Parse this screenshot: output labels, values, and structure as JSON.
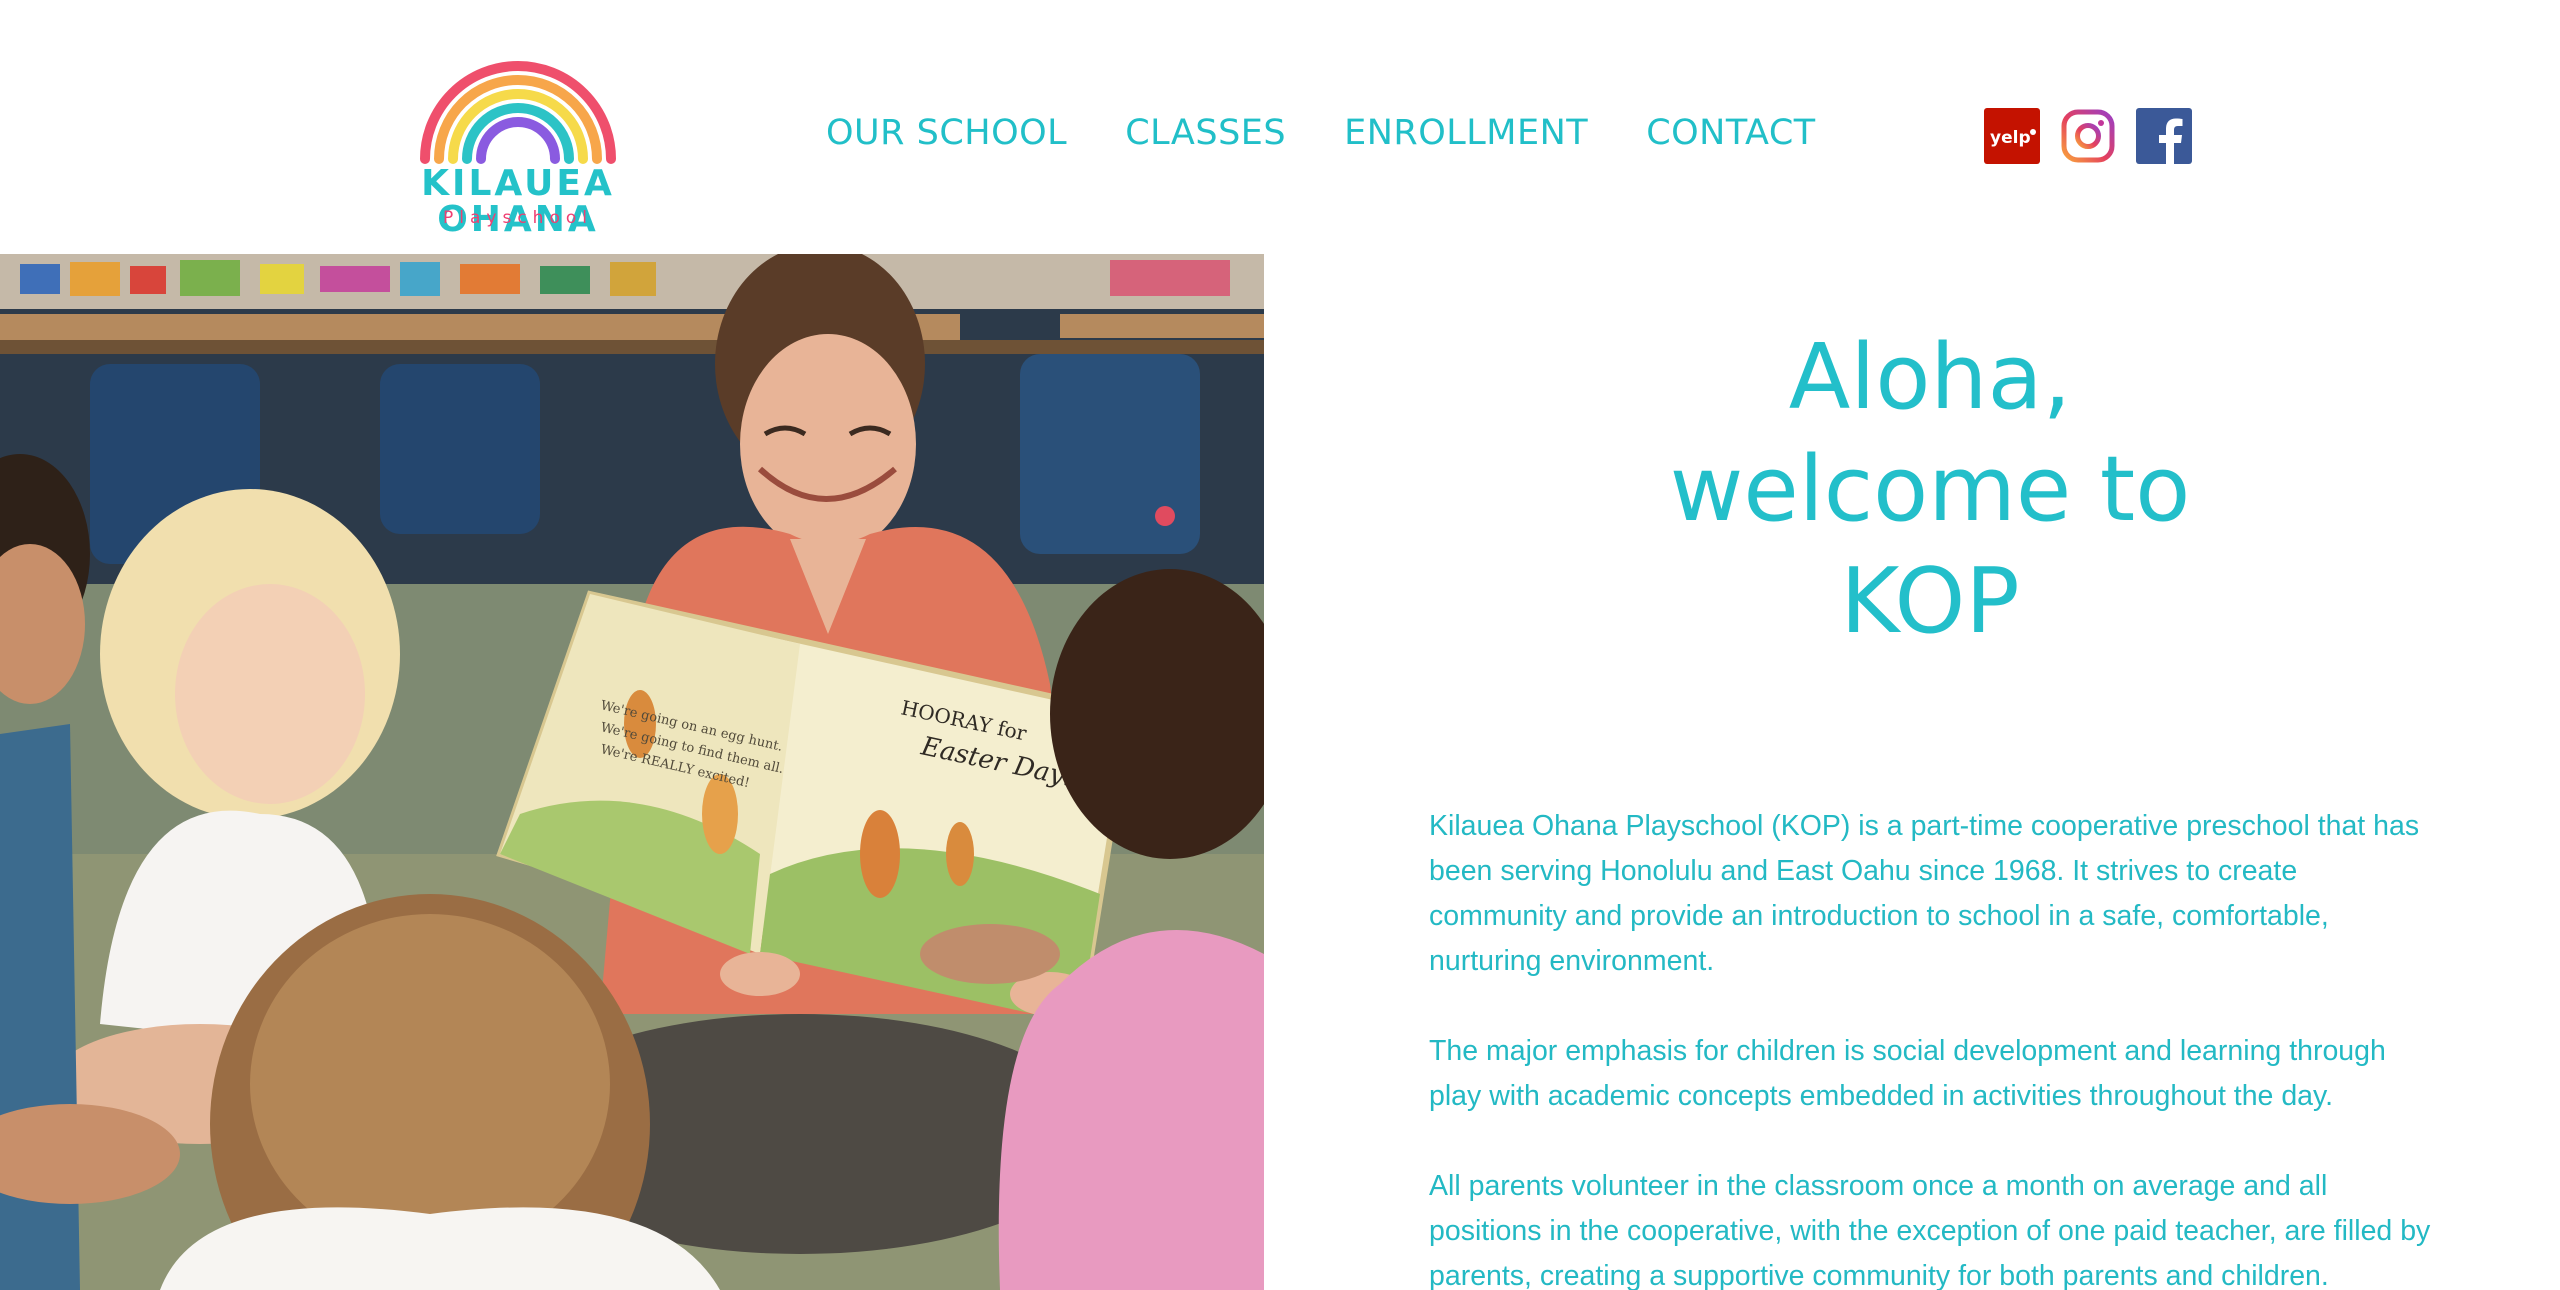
{
  "logo": {
    "title": "KILAUEA OHANA",
    "subtitle": "Playschool",
    "rainbow_colors": [
      "#ef4f6c",
      "#f7a64a",
      "#f6da4a",
      "#2cc3c6",
      "#8a5be0"
    ]
  },
  "nav": {
    "items": [
      {
        "label": "OUR SCHOOL"
      },
      {
        "label": "CLASSES"
      },
      {
        "label": "ENROLLMENT"
      },
      {
        "label": "CONTACT"
      }
    ]
  },
  "social": {
    "icons": [
      "yelp-icon",
      "instagram-icon",
      "facebook-icon"
    ],
    "yelp_label": "yelp"
  },
  "hero": {
    "image_subject": "teacher-reading-to-children-photo",
    "book_text": {
      "title_line1": "HOORAY for",
      "title_line2": "Easter Day!",
      "page_line1": "We're going on an egg hunt.",
      "page_line2": "We're going to find them all.",
      "page_line3": "We're REALLY excited!"
    }
  },
  "main": {
    "heading": {
      "line1": "Aloha,",
      "line2": "welcome to",
      "line3": "KOP"
    },
    "paragraphs": [
      "Kilauea Ohana Playschool (KOP) is a part-time cooperative preschool that has been serving Honolulu and East Oahu since 1968. It strives to create community and provide an introduction to school in a safe, comfortable, nurturing environment.",
      "The major emphasis for children is social development and learning through play with academic concepts embedded in activities throughout the day.",
      "All parents volunteer in the classroom once a month on average and all positions in the cooperative, with the exception of one paid teacher, are filled by parents, creating a supportive community for both parents and children."
    ]
  },
  "colors": {
    "accent": "#23bfca",
    "logo_pink": "#ef3f72",
    "yelp_red": "#c41200",
    "facebook_blue": "#3b5998"
  }
}
